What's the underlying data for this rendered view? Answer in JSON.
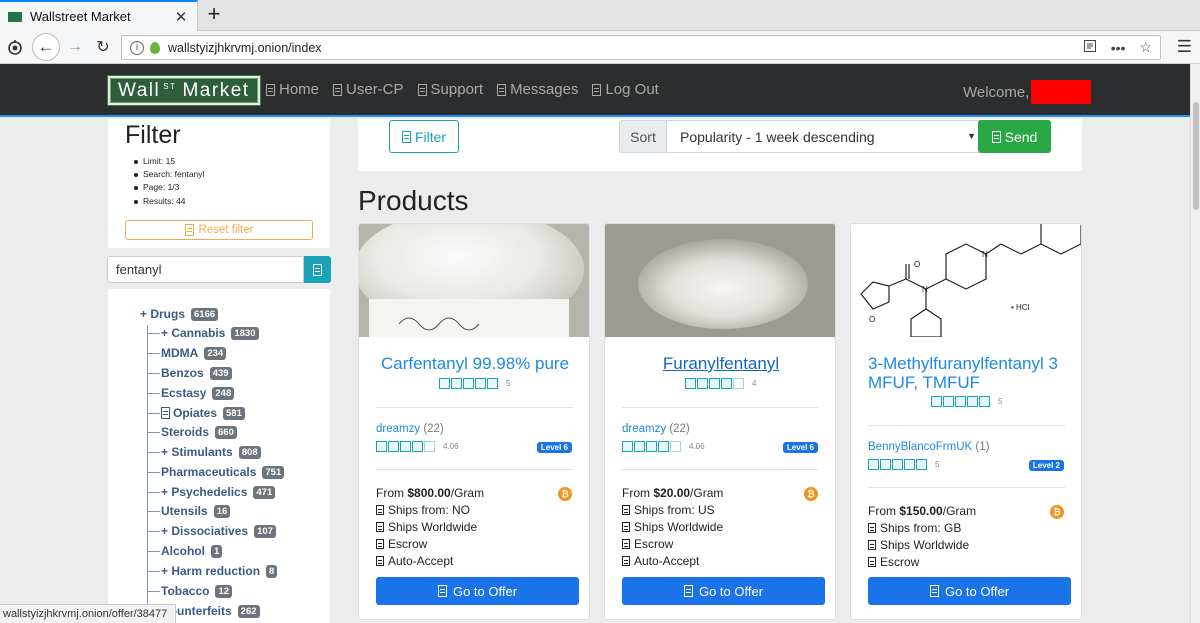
{
  "browser": {
    "tab_title": "Wallstreet Market",
    "url": "wallstyizjhkrvmj.onion/index",
    "status_url": "wallstyizjhkrvmj.onion/offer/38477"
  },
  "site": {
    "logo_main": "Wall",
    "logo_sup": "ST",
    "logo_rest": "Market",
    "nav": [
      "Home",
      "User-CP",
      "Support",
      "Messages",
      "Log Out"
    ],
    "welcome": "Welcome,"
  },
  "filter": {
    "title": "Filter",
    "items": [
      "Limit: 15",
      "Search: fentanyl",
      "Page: 1/3",
      "Results: 44"
    ],
    "reset_label": "Reset filter",
    "search_value": "fentanyl"
  },
  "categories": {
    "root": {
      "label": "+ Drugs",
      "count": "6166"
    },
    "items": [
      {
        "label": "+ Cannabis",
        "count": "1830"
      },
      {
        "label": "MDMA",
        "count": "234"
      },
      {
        "label": "Benzos",
        "count": "439"
      },
      {
        "label": "Ecstasy",
        "count": "248"
      },
      {
        "label": "Opiates",
        "count": "581"
      },
      {
        "label": "Steroids",
        "count": "660"
      },
      {
        "label": "+ Stimulants",
        "count": "808"
      },
      {
        "label": "Pharmaceuticals",
        "count": "751"
      },
      {
        "label": "+ Psychedelics",
        "count": "471"
      },
      {
        "label": "Utensils",
        "count": "16"
      },
      {
        "label": "+ Dissociatives",
        "count": "107"
      },
      {
        "label": "Alcohol",
        "count": "1"
      },
      {
        "label": "+ Harm reduction",
        "count": "8"
      },
      {
        "label": "Tobacco",
        "count": "12"
      },
      {
        "label": "Counterfeits",
        "count": "262"
      }
    ]
  },
  "toolbar": {
    "filter_label": "Filter",
    "sort_label": "Sort",
    "sort_value": "Popularity - 1 week descending",
    "send_label": "Send"
  },
  "products_heading": "Products",
  "products": [
    {
      "title": "Carfentanyl 99.98% pure",
      "rating": 5,
      "rating_text": "5",
      "vendor": "dreamzy",
      "vendor_count": "(22)",
      "vendor_rating": 4,
      "vendor_score": "4.06",
      "level": "Level 6",
      "price_prefix": "From ",
      "price": "$800.00",
      "price_unit": "/Gram",
      "features": [
        "Ships from: NO",
        "Ships Worldwide",
        "Escrow",
        "Auto-Accept"
      ],
      "button": "Go to Offer"
    },
    {
      "title": "Furanylfentanyl",
      "rating": 4,
      "rating_text": "4",
      "vendor": "dreamzy",
      "vendor_count": "(22)",
      "vendor_rating": 4,
      "vendor_score": "4.06",
      "level": "Level 6",
      "price_prefix": "From ",
      "price": "$20.00",
      "price_unit": "/Gram",
      "features": [
        "Ships from: US",
        "Ships Worldwide",
        "Escrow",
        "Auto-Accept"
      ],
      "button": "Go to Offer"
    },
    {
      "title": "3-Methylfuranylfentanyl 3 MFUF, TMFUF",
      "rating": 5,
      "rating_text": "5",
      "vendor": "BennyBlancoFrmUK",
      "vendor_count": "(1)",
      "vendor_rating": 5,
      "vendor_score": "5",
      "level": "Level 2",
      "price_prefix": "From ",
      "price": "$150.00",
      "price_unit": "/Gram",
      "features": [
        "Ships from: GB",
        "Ships Worldwide",
        "Escrow"
      ],
      "button": "Go to Offer",
      "image_label": "• HCl"
    }
  ],
  "colors": {
    "header_bg": "#2b2d2f",
    "link_blue": "#1e88e5",
    "send_green": "#28a745",
    "info_teal": "#17a2b8",
    "primary": "#1a73e8"
  }
}
